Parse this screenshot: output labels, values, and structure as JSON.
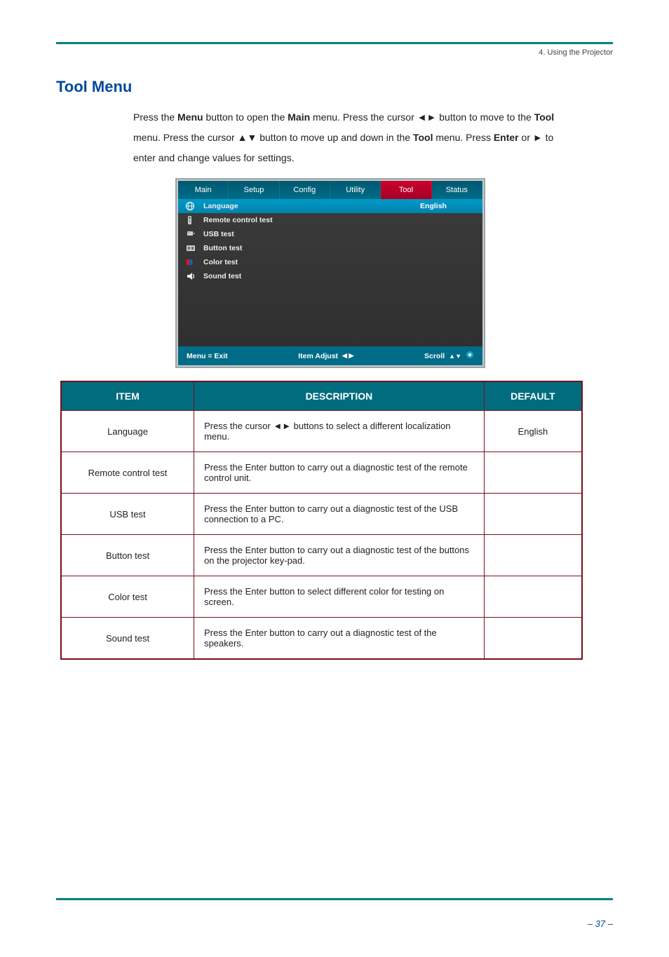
{
  "header": {
    "label": "4. Using the Projector"
  },
  "section": {
    "title": "Tool Menu"
  },
  "instructions": {
    "line1a": "Press the ",
    "menu": "Menu",
    "line1b": " button to open the ",
    "main": "Main",
    "line1c": " menu. Press the cursor ",
    "line1d": " button to move to the ",
    "tool": "Tool",
    "line2a": "menu. Press the cursor ",
    "line2b": " button to move up and down in the ",
    "line2c": " menu. Press ",
    "enter": "Enter",
    "line2d": " or ",
    "line2e": " to",
    "line3": "enter and change values for settings."
  },
  "osd": {
    "tabs": [
      "Main",
      "Setup",
      "Config",
      "Utility",
      "Tool",
      "Status"
    ],
    "selected_tab_index": 4,
    "items": [
      {
        "icon": "globe",
        "label": "Language",
        "value": "English",
        "highlight": true
      },
      {
        "icon": "remote",
        "label": "Remote control test",
        "value": ""
      },
      {
        "icon": "usb",
        "label": "USB test",
        "value": ""
      },
      {
        "icon": "button",
        "label": "Button test",
        "value": ""
      },
      {
        "icon": "colors",
        "label": "Color test",
        "value": ""
      },
      {
        "icon": "speaker",
        "label": "Sound test",
        "value": ""
      }
    ],
    "footer": {
      "exit": "Menu = Exit",
      "adjust": "Item Adjust",
      "scroll": "Scroll"
    }
  },
  "table": {
    "headers": {
      "item": "ITEM",
      "description": "DESCRIPTION",
      "default": "DEFAULT"
    },
    "rows": [
      {
        "item": "Language",
        "description_pre": "Press the cursor ",
        "description_post": " buttons to select a different localization menu.",
        "show_arrows": true,
        "default": "English"
      },
      {
        "item": "Remote control test",
        "description_pre": "Press the Enter button to carry out a diagnostic test of the remote control unit.",
        "description_post": "",
        "show_arrows": false,
        "default": ""
      },
      {
        "item": "USB test",
        "description_pre": "Press the Enter button to carry out a diagnostic test of the USB connection to a PC.",
        "description_post": "",
        "show_arrows": false,
        "default": ""
      },
      {
        "item": "Button test",
        "description_pre": "Press the Enter button to carry out a diagnostic test of the buttons on the projector key-pad.",
        "description_post": "",
        "show_arrows": false,
        "default": ""
      },
      {
        "item": "Color test",
        "description_pre": "Press the Enter button to select different color for testing on screen.",
        "description_post": "",
        "show_arrows": false,
        "default": ""
      },
      {
        "item": "Sound test",
        "description_pre": "Press the Enter button to carry out a diagnostic test of the speakers.",
        "description_post": "",
        "show_arrows": false,
        "default": ""
      }
    ]
  },
  "footer": {
    "page": "– 37 –"
  }
}
